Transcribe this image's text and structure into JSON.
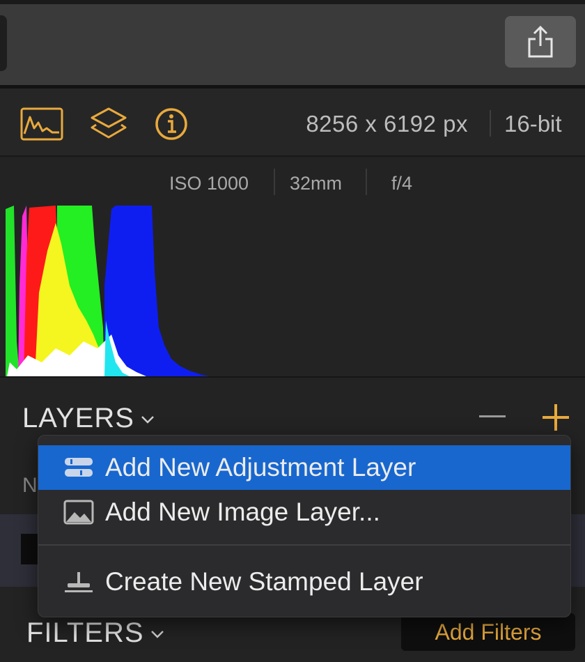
{
  "info": {
    "dimensions": "8256 x 6192 px",
    "bit_depth": "16-bit",
    "iso": "ISO 1000",
    "focal_length": "32mm",
    "aperture": "f/4"
  },
  "layers": {
    "title": "LAYERS",
    "partial_text": "N"
  },
  "filters": {
    "title": "FILTERS",
    "add_label": "Add Filters"
  },
  "menu": {
    "items": [
      {
        "label": "Add New Adjustment Layer",
        "icon": "adjustment-layer-icon",
        "selected": true
      },
      {
        "label": "Add New Image Layer...",
        "icon": "image-layer-icon",
        "selected": false
      },
      {
        "label": "Create New Stamped Layer",
        "icon": "stamp-icon",
        "selected": false
      }
    ]
  },
  "colors": {
    "accent": "#e8a93d",
    "selection": "#1867cf",
    "background": "#232323"
  }
}
